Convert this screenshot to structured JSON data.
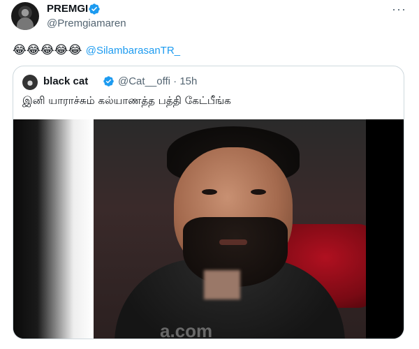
{
  "tweet": {
    "author_name": "PREMGI",
    "author_handle": "@Premgiamaren",
    "emojis": "😂😂😂😂😂",
    "mention": "@SilambarasanTR_"
  },
  "quote": {
    "author_name": "black cat",
    "author_handle": "@Cat__offi · 15h",
    "text": "இனி யாராச்சும் கல்யாணத்த பத்தி கேட்பீங்க",
    "video_watermark": "a.com"
  },
  "colors": {
    "link": "#1d9bf0",
    "verified": "#1d9bf0",
    "secondary_text": "#536471",
    "border": "#cfd9de"
  },
  "icons": {
    "verified": "verified-badge-icon",
    "more": "more-horizontal-icon"
  }
}
